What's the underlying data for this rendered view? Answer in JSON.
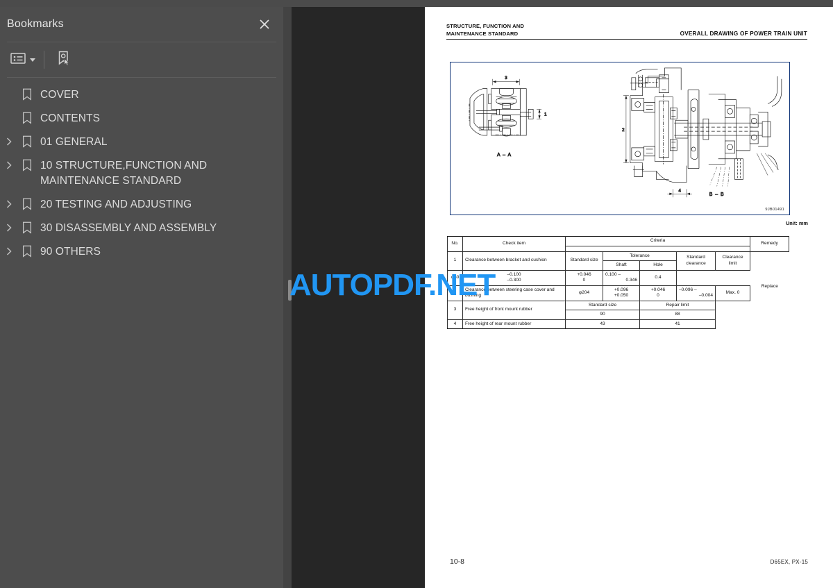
{
  "window": {
    "topbar_color": "#4b4b4b",
    "panel_bg": "#4d4d4d",
    "viewer_bg": "#262626"
  },
  "sidebar": {
    "title": "Bookmarks",
    "close_icon": "close-icon",
    "toolbar": {
      "list_options_icon": "list-options-icon",
      "list_options_caret": "chevron-down-icon",
      "select_bookmark_icon": "select-bookmark-icon"
    },
    "items": [
      {
        "label": "COVER",
        "expandable": false
      },
      {
        "label": "CONTENTS",
        "expandable": false
      },
      {
        "label": "01 GENERAL",
        "expandable": true
      },
      {
        "label": "10 STRUCTURE,FUNCTION AND MAINTENANCE STANDARD",
        "expandable": true
      },
      {
        "label": "20 TESTING AND ADJUSTING",
        "expandable": true
      },
      {
        "label": "30 DISASSEMBLY AND ASSEMBLY",
        "expandable": true
      },
      {
        "label": "90 OTHERS",
        "expandable": true
      }
    ]
  },
  "watermark": {
    "text": "AUTOPDF.NET",
    "color": "#2196f3"
  },
  "document": {
    "header_left_line1": "STRUCTURE, FUNCTION AND",
    "header_left_line2": "MAINTENANCE STANDARD",
    "header_right": "OVERALL DRAWING OF POWER TRAIN UNIT",
    "figure": {
      "id": "9JB01491",
      "section_labels": [
        "A – A",
        "B – B"
      ],
      "callouts": [
        "1",
        "2",
        "3",
        "4"
      ]
    },
    "unit_note": "Unit: mm",
    "table": {
      "headers": {
        "no": "No.",
        "check_item": "Check item",
        "criteria": "Criteria",
        "remedy": "Remedy",
        "standard_size": "Standard size",
        "tolerance": "Tolerance",
        "shaft": "Shaft",
        "hole": "Hole",
        "standard_clearance": "Standard clearance",
        "clearance_limit": "Clearance limit",
        "standard_size_2": "Standard size",
        "repair_limit": "Repair limit"
      },
      "rows": [
        {
          "no": "1",
          "check_item": "Clearance between bracket and cushion",
          "standard_size": "φ60",
          "shaft_upper": "–0.100",
          "shaft_lower": "–0.300",
          "hole_upper": "+0.046",
          "hole_lower": "0",
          "clearance_upper": "0.100 –",
          "clearance_lower": "0.346",
          "clearance_limit": "0.4"
        },
        {
          "no": "2",
          "check_item": "Clearance between steering case cover and bushing",
          "standard_size": "φ204",
          "shaft_upper": "+0.096",
          "shaft_lower": "+0.050",
          "hole_upper": "+0.046",
          "hole_lower": "0",
          "clearance_upper": "–0.096 –",
          "clearance_lower": "–0.004",
          "clearance_limit": "Max. 0"
        },
        {
          "no": "3",
          "check_item": "Free height of front mount rubber",
          "standard_size_val": "90",
          "repair_limit_val": "88"
        },
        {
          "no": "4",
          "check_item": "Free height of rear mount rubber",
          "standard_size_val": "43",
          "repair_limit_val": "41"
        }
      ],
      "remedy": "Replace"
    },
    "footer": {
      "page_number": "10-8",
      "model": "D65EX, PX-15"
    }
  }
}
